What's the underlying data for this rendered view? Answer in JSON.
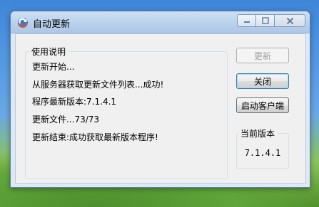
{
  "window": {
    "title": "自动更新",
    "icon": "app-update-icon"
  },
  "caption_buttons": {
    "minimize_icon": "minimize-icon",
    "maximize_icon": "maximize-icon",
    "close_icon": "close-icon"
  },
  "log_group": {
    "legend": "使用说明",
    "lines": [
      "更新开始...",
      "从服务器获取更新文件列表...成功!",
      "程序最新版本:7.1.4.1",
      "更新文件...73/73",
      "更新结束:成功获取最新版本程序!"
    ]
  },
  "buttons": {
    "update_label": "更新",
    "close_label": "关闭",
    "launch_client_label": "启动客户端"
  },
  "current_version": {
    "legend": "当前版本",
    "value": "7.1.4.1"
  }
}
